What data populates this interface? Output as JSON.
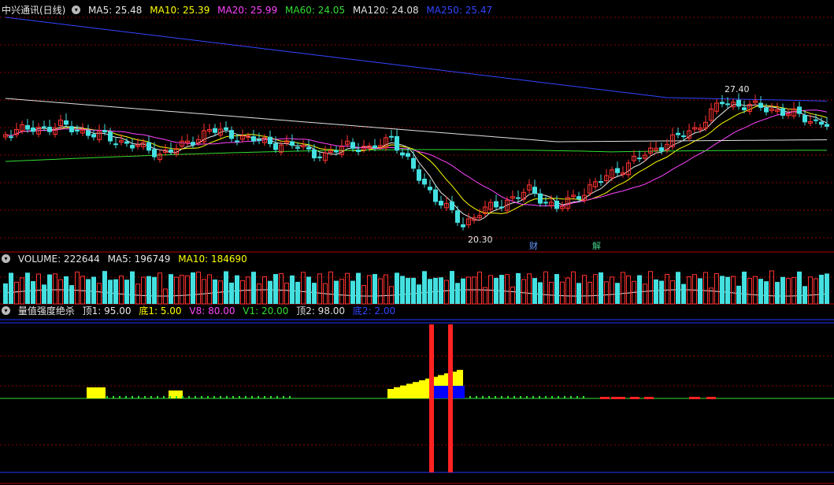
{
  "stock": {
    "title": "中兴通讯(日线)",
    "ma": [
      {
        "label": "MA5: 25.48",
        "color": "#e8e8e8"
      },
      {
        "label": "MA10: 25.39",
        "color": "#ffff00"
      },
      {
        "label": "MA20: 25.99",
        "color": "#ff44ff"
      },
      {
        "label": "MA60: 24.05",
        "color": "#33dd33"
      },
      {
        "label": "MA120: 24.08",
        "color": "#e0e0e0"
      },
      {
        "label": "MA250: 25.47",
        "color": "#3344ff"
      }
    ],
    "high_label": "27.40",
    "low_label": "20.30",
    "events": [
      "财",
      "解"
    ]
  },
  "volume": {
    "title": "VOLUME: 222644",
    "ma5": "MA5: 196749",
    "ma10": "MA10: 184690"
  },
  "indicator": {
    "title": "量值强度绝杀",
    "params": [
      {
        "label": "顶1: 95.00",
        "color": "#ffffff"
      },
      {
        "label": "底1: 5.00",
        "color": "#ffff00"
      },
      {
        "label": "V8: 80.00",
        "color": "#ff44ff"
      },
      {
        "label": "V1: 20.00",
        "color": "#33dd33"
      },
      {
        "label": "顶2: 98.00",
        "color": "#e0e0e0"
      },
      {
        "label": "底2: 2.00",
        "color": "#3344ff"
      }
    ]
  },
  "colors": {
    "up": "#ff3333",
    "down": "#44e0e0",
    "grid": "#8b0000",
    "separator": "#aa0000"
  }
}
